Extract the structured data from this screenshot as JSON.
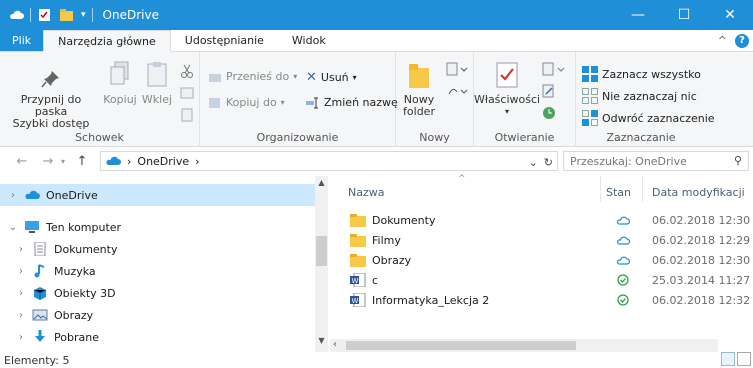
{
  "window": {
    "title": "OneDrive",
    "minimize_glyph": "—",
    "maximize_glyph": "☐",
    "close_glyph": "✕"
  },
  "ribbon_tabs": [
    {
      "label": "Plik"
    },
    {
      "label": "Narzędzia główne"
    },
    {
      "label": "Udostępnianie"
    },
    {
      "label": "Widok"
    }
  ],
  "ribbon_right": {
    "collapse_glyph": "^",
    "help_glyph": "?"
  },
  "ribbon": {
    "schowek": {
      "label": "Schowek",
      "pin_label_1": "Przypnij do paska",
      "pin_label_2": "Szybki dostęp",
      "copy_label": "Kopiuj",
      "paste_label": "Wklej"
    },
    "organizowanie": {
      "label": "Organizowanie",
      "move_to": "Przenieś do",
      "copy_to": "Kopiuj do",
      "delete": "Usuń",
      "rename": "Zmień nazwę"
    },
    "nowy": {
      "label": "Nowy",
      "new_folder_1": "Nowy",
      "new_folder_2": "folder"
    },
    "otwieranie": {
      "label": "Otwieranie",
      "properties": "Właściwości"
    },
    "zaznaczanie": {
      "label": "Zaznaczanie",
      "select_all": "Zaznacz wszystko",
      "select_none": "Nie zaznaczaj nic",
      "invert": "Odwróć zaznaczenie"
    }
  },
  "address": {
    "back_glyph": "←",
    "forward_glyph": "→",
    "up_glyph": "↑",
    "path_sep": "›",
    "path": "OneDrive",
    "dropdown_glyph": "⌄",
    "refresh_glyph": "↻",
    "search_placeholder": "Przeszukaj: OneDrive",
    "search_glyph": "⚲"
  },
  "nav_pane": {
    "items": [
      {
        "label": "OneDrive",
        "chevron": "›",
        "icon": "onedrive-cloud-icon",
        "selected": true
      },
      {
        "label": "Ten komputer",
        "chevron": "⌄",
        "icon": "computer-icon",
        "selected": false
      },
      {
        "label": "Dokumenty",
        "chevron": "›",
        "icon": "documents-icon",
        "selected": false
      },
      {
        "label": "Muzyka",
        "chevron": "›",
        "icon": "music-note-icon",
        "selected": false
      },
      {
        "label": "Obiekty 3D",
        "chevron": "›",
        "icon": "cube-3d-icon",
        "selected": false
      },
      {
        "label": "Obrazy",
        "chevron": "›",
        "icon": "pictures-icon",
        "selected": false
      },
      {
        "label": "Pobrane",
        "chevron": "›",
        "icon": "download-arrow-icon",
        "selected": false
      }
    ]
  },
  "file_list": {
    "columns": {
      "name": "Nazwa",
      "status": "Stan",
      "modified": "Data modyfikacji"
    },
    "rows": [
      {
        "name": "Dokumenty",
        "type": "folder",
        "status": "cloud",
        "modified": "06.02.2018 12:30"
      },
      {
        "name": "Filmy",
        "type": "folder",
        "status": "cloud",
        "modified": "06.02.2018 12:29"
      },
      {
        "name": "Obrazy",
        "type": "folder",
        "status": "cloud",
        "modified": "06.02.2018 12:30"
      },
      {
        "name": "c",
        "type": "doc",
        "status": "synced",
        "modified": "25.03.2014 11:27"
      },
      {
        "name": "Informatyka_Lekcja 2",
        "type": "doc",
        "status": "synced",
        "modified": "06.02.2018 12:32"
      }
    ]
  },
  "status_bar": {
    "items_text": "Elementy: 5"
  },
  "colors": {
    "accent": "#1f8fd8",
    "selected": "#cce8ff",
    "synced": "#2ea043",
    "folder": "#f7c948"
  }
}
